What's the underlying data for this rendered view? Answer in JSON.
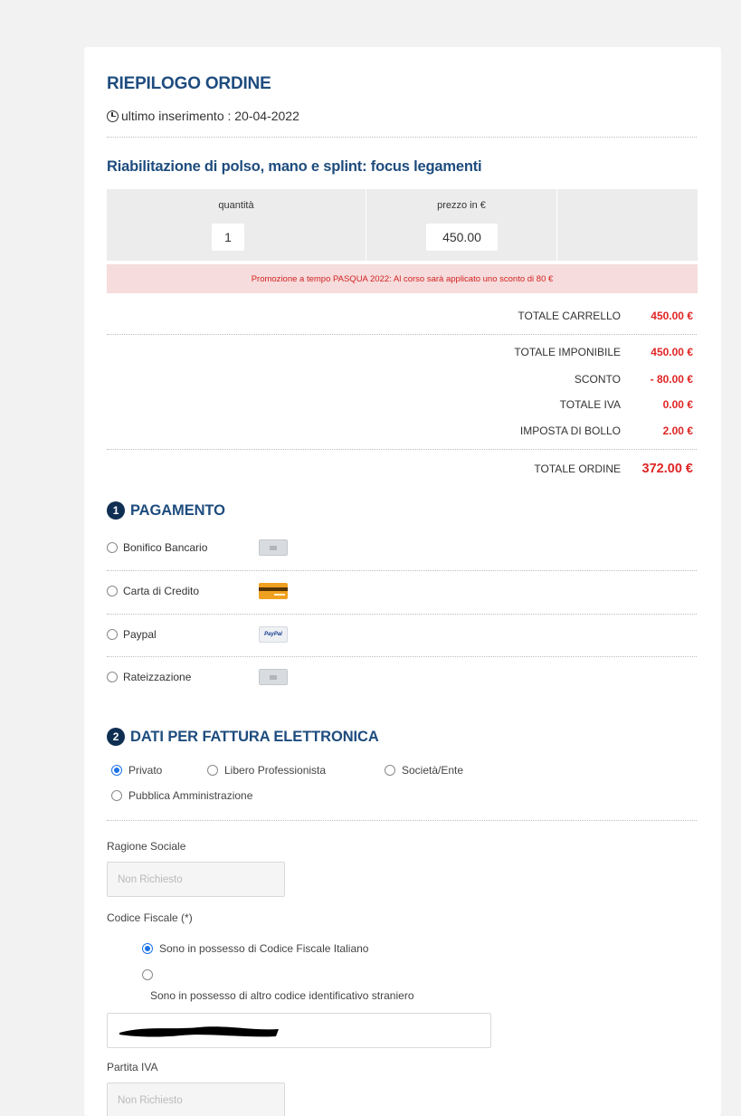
{
  "summary": {
    "title": "RIEPILOGO ORDINE",
    "last_insert": "ultimo inserimento : 20-04-2022"
  },
  "course": {
    "name": "Riabilitazione di polso, mano e splint: focus legamenti",
    "qty_header": "quantità",
    "price_header": "prezzo in €",
    "qty": "1",
    "price": "450.00",
    "promo": "Promozione a tempo PASQUA 2022: Al corso sarà applicato uno sconto di 80 €"
  },
  "totals": {
    "cart_label": "TOTALE CARRELLO",
    "cart_value": "450.00 €",
    "taxable_label": "TOTALE IMPONIBILE",
    "taxable_value": "450.00 €",
    "discount_label": "SCONTO",
    "discount_value": "- 80.00 €",
    "vat_label": "TOTALE IVA",
    "vat_value": "0.00 €",
    "stamp_label": "IMPOSTA DI BOLLO",
    "stamp_value": "2.00 €",
    "order_label": "TOTALE ORDINE",
    "order_value": "372.00 €"
  },
  "payment": {
    "step": "1",
    "title": "PAGAMENTO",
    "methods": [
      {
        "label": "Bonifico Bancario",
        "icon": "bank-icon"
      },
      {
        "label": "Carta di Credito",
        "icon": "credit-card-icon"
      },
      {
        "label": "Paypal",
        "icon": "paypal-icon",
        "icon_text": "PayPal"
      },
      {
        "label": "Rateizzazione",
        "icon": "installment-icon"
      }
    ]
  },
  "invoice": {
    "step": "2",
    "title": "DATI PER FATTURA ELETTRONICA",
    "types": [
      "Privato",
      "Libero Professionista",
      "Società/Ente",
      "Pubblica Amministrazione"
    ],
    "selected_type": "Privato",
    "company_label": "Ragione Sociale",
    "company_placeholder": "Non Richiesto",
    "tax_code_label": "Codice Fiscale (*)",
    "tax_code_opt1": "Sono in possesso di Codice Fiscale Italiano",
    "tax_code_opt2": "Sono in possesso di altro codice identificativo straniero",
    "vat_label": "Partita IVA",
    "vat_placeholder": "Non Richiesto"
  },
  "colors": {
    "accent": "#1e4c7e",
    "price_red": "#e02424",
    "promo_bg": "#f6dcdc",
    "radio_blue": "#1a73e8"
  }
}
